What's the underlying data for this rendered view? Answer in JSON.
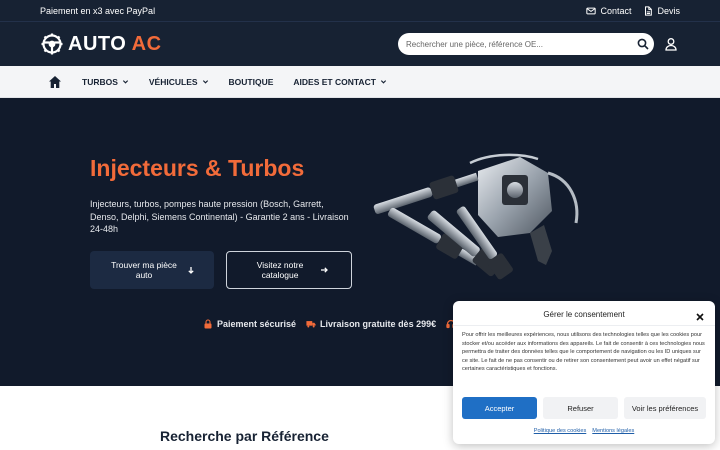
{
  "topbar": {
    "promo": "Paiement en x3 avec PayPal",
    "contact": "Contact",
    "quote": "Devis"
  },
  "header": {
    "logo_main": "AUTO",
    "logo_accent": "AC",
    "search_placeholder": "Rechercher une pièce, référence OE..."
  },
  "nav": {
    "items": [
      "TURBOS",
      "VÉHICULES",
      "BOUTIQUE",
      "AIDES ET CONTACT"
    ]
  },
  "hero": {
    "title": "Injecteurs & Turbos",
    "description": "Injecteurs, turbos, pompes haute pression (Bosch, Garrett, Denso, Delphi, Siemens Continental) - Garantie 2 ans - Livraison 24-48h",
    "primary_button": "Trouver ma pièce auto",
    "secondary_button": "Visitez notre catalogue",
    "features": [
      "Paiement sécurisé",
      "Livraison gratuite dès 299€"
    ]
  },
  "section": {
    "title": "Recherche par Référence"
  },
  "consent": {
    "title": "Gérer le consentement",
    "body": "Pour offrir les meilleures expériences, nous utilisons des technologies telles que les cookies pour stocker et/ou accéder aux informations des appareils. Le fait de consentir à ces technologies nous permettra de traiter des données telles que le comportement de navigation ou les ID uniques sur ce site. Le fait de ne pas consentir ou de retirer son consentement peut avoir un effet négatif sur certaines caractéristiques et fonctions.",
    "accept": "Accepter",
    "refuse": "Refuser",
    "preferences": "Voir les préférences",
    "cookie_policy": "Politique des cookies",
    "legal": "Mentions légales"
  },
  "colors": {
    "dark": "#172233",
    "hero": "#111a2b",
    "accent": "#f26b3a",
    "primary_blue": "#1f6fc5"
  }
}
